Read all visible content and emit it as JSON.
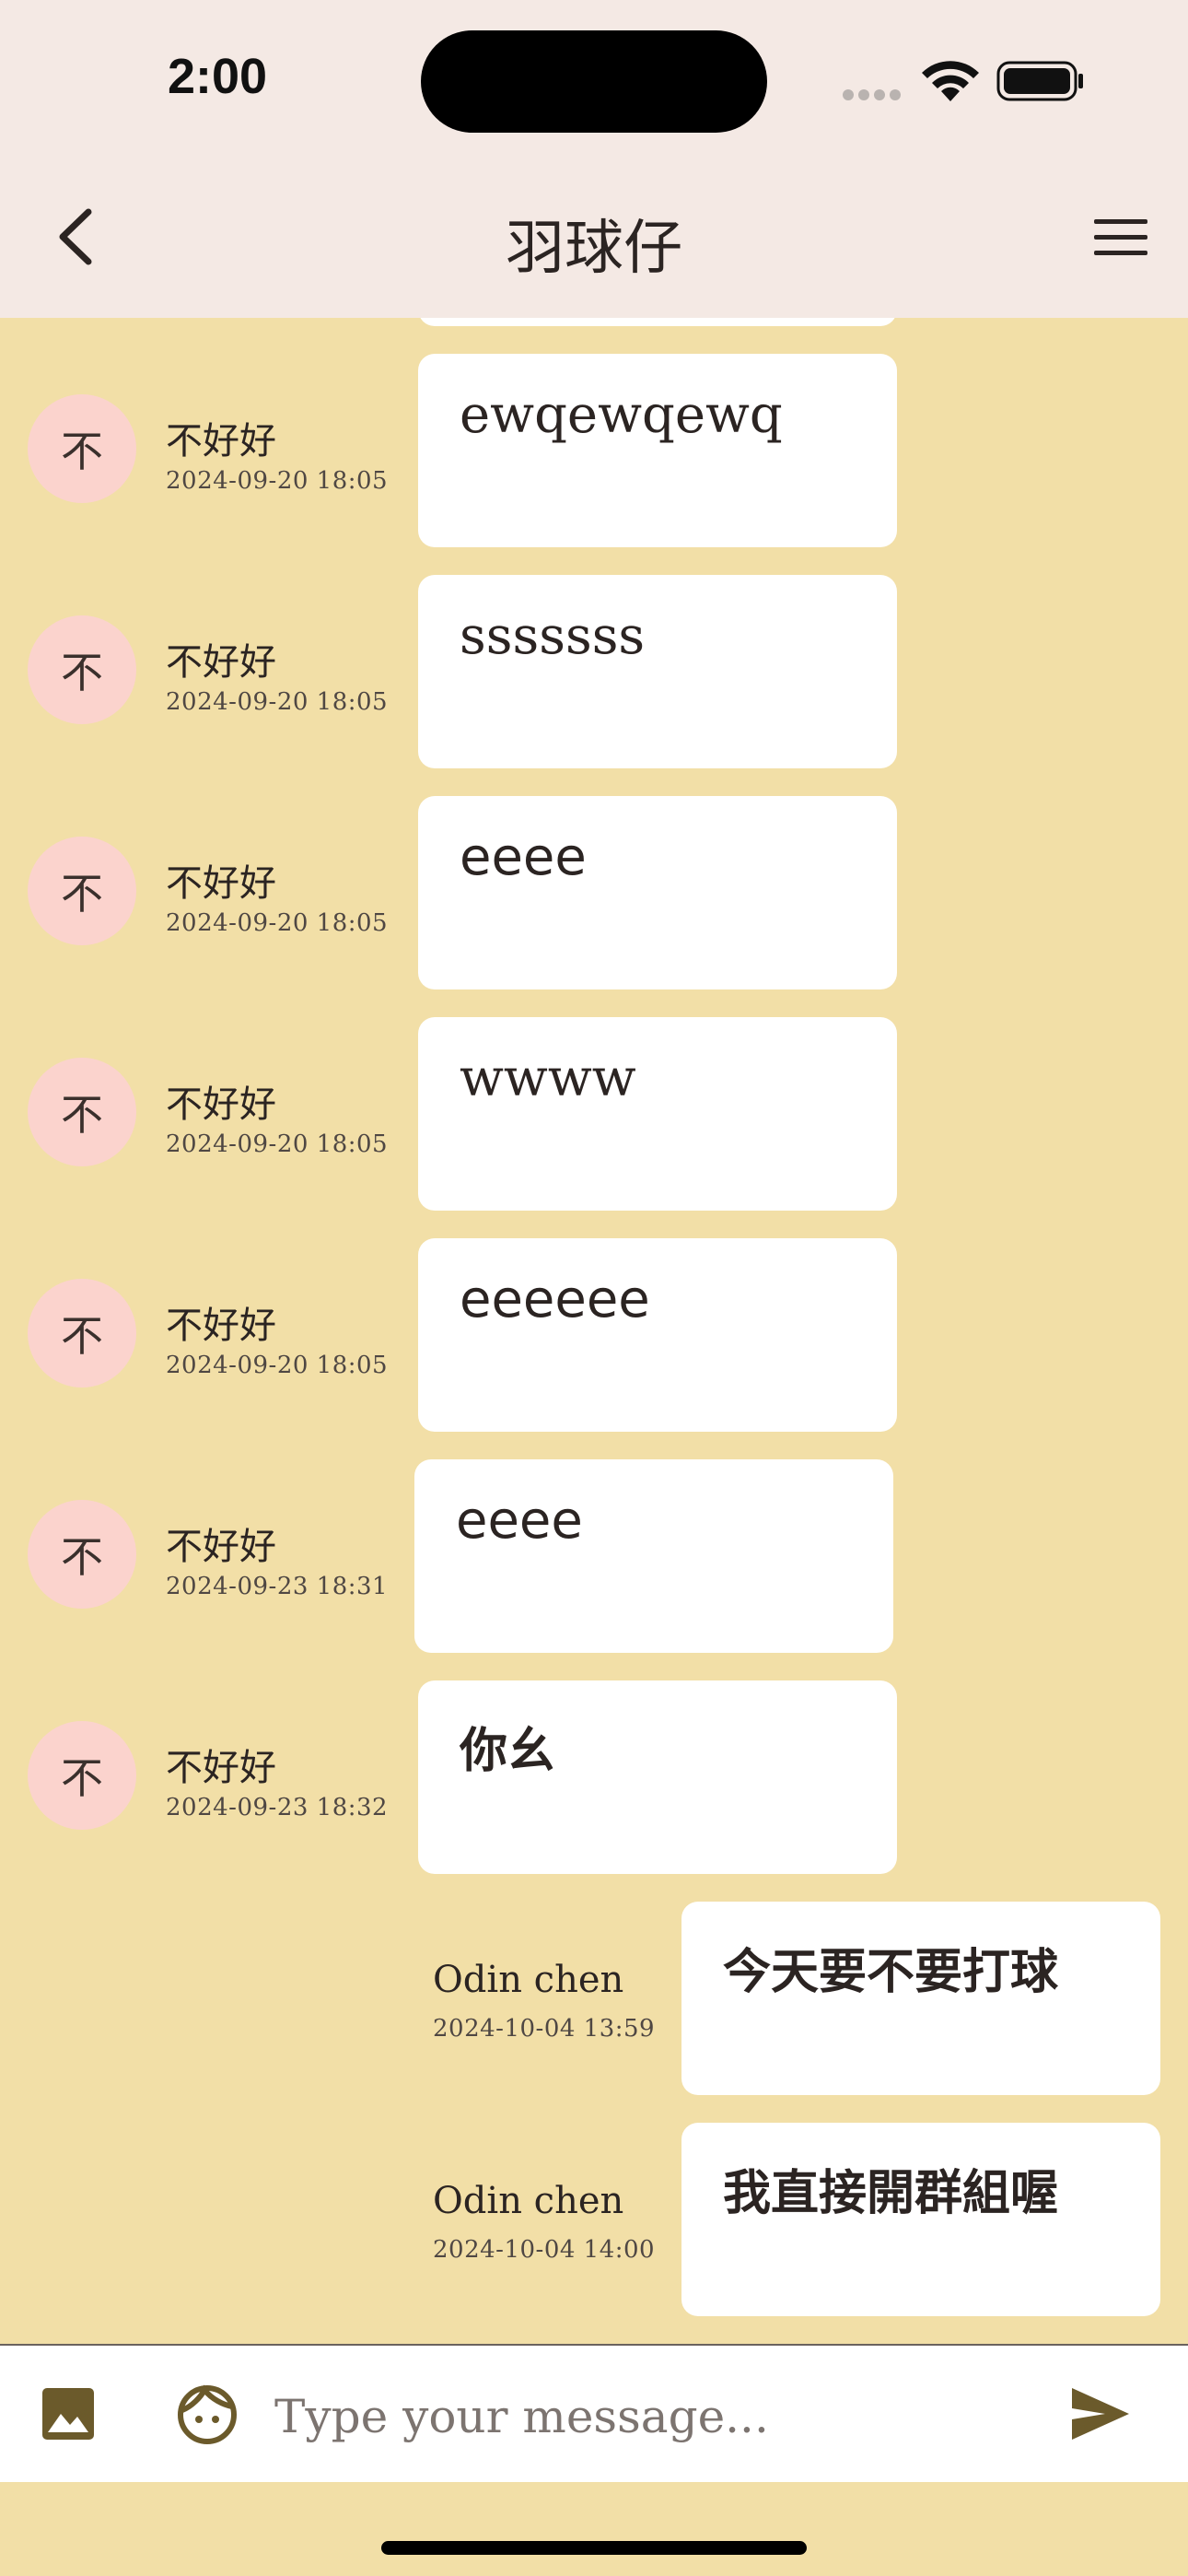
{
  "status_bar": {
    "time": "2:00"
  },
  "header": {
    "title": "羽球仔"
  },
  "messages": [
    {
      "avatar": "不",
      "name": "不好好",
      "time": "2024-09-20 18:05",
      "text": "ewqewqewq"
    },
    {
      "avatar": "不",
      "name": "不好好",
      "time": "2024-09-20 18:05",
      "text": "sssssss"
    },
    {
      "avatar": "不",
      "name": "不好好",
      "time": "2024-09-20 18:05",
      "text": "eeee"
    },
    {
      "avatar": "不",
      "name": "不好好",
      "time": "2024-09-20 18:05",
      "text": "wwww"
    },
    {
      "avatar": "不",
      "name": "不好好",
      "time": "2024-09-20 18:05",
      "text": "eeeeee"
    },
    {
      "avatar": "不",
      "name": "不好好",
      "time": "2024-09-23 18:31",
      "text": "eeee"
    },
    {
      "avatar": "不",
      "name": "不好好",
      "time": "2024-09-23 18:32",
      "text": "你幺"
    },
    {
      "name": "Odin chen",
      "time": "2024-10-04 13:59",
      "text": "今天要不要打球"
    },
    {
      "name": "Odin chen",
      "time": "2024-10-04 14:00",
      "text": "我直接開群組喔"
    }
  ],
  "composer": {
    "placeholder": "Type your message..."
  },
  "colors": {
    "background": "#f2dfa7",
    "header": "#f4e9e4",
    "avatar": "#fbd3cd",
    "bubble": "#ffffff",
    "icon": "#6b5a2b"
  },
  "icons": [
    "back-icon",
    "menu-icon",
    "image-icon",
    "emoji-icon",
    "send-icon",
    "wifi-icon",
    "battery-icon"
  ]
}
